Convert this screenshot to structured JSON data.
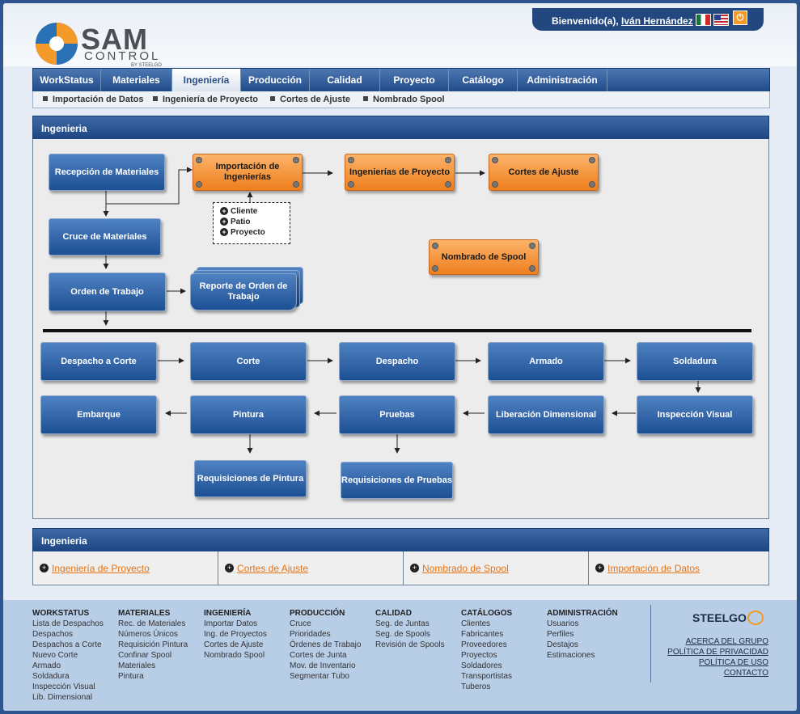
{
  "header": {
    "welcome": "Bienvenido(a),",
    "user": "Iván Hernández",
    "logo_main": "SAM",
    "logo_sub": "CONTROL",
    "logo_by": "BY STEELGO"
  },
  "nav": {
    "tabs": [
      "WorkStatus",
      "Materiales",
      "Ingeniería",
      "Producción",
      "Calidad",
      "Proyecto",
      "Catálogo",
      "Administración"
    ],
    "active": "Ingeniería"
  },
  "subnav": [
    "Importación de Datos",
    "Ingeniería de Proyecto",
    "Cortes de Ajuste",
    "Nombrado Spool"
  ],
  "panel1": {
    "title": "Ingenieria"
  },
  "diagram": {
    "recepcion": "Recepción de Materiales",
    "importacion": "Importación de Ingenierías",
    "ingenierias": "Ingenierías de Proyecto",
    "cortes_ajuste": "Cortes de Ajuste",
    "legend": [
      "Cliente",
      "Patio",
      "Proyecto"
    ],
    "cruce": "Cruce de Materiales",
    "nombrado": "Nombrado de Spool",
    "orden": "Orden de Trabajo",
    "reporte": "Reporte de Orden de Trabajo",
    "despacho_corte": "Despacho a Corte",
    "corte": "Corte",
    "despacho": "Despacho",
    "armado": "Armado",
    "soldadura": "Soldadura",
    "embarque": "Embarque",
    "pintura": "Pintura",
    "pruebas": "Pruebas",
    "liberacion": "Liberación Dimensional",
    "inspeccion": "Inspección Visual",
    "req_pintura": "Requisiciones de Pintura",
    "req_pruebas": "Requisiciones de Pruebas"
  },
  "panel2": {
    "title": "Ingenieria",
    "links": [
      "Ingeniería de Proyecto",
      "Cortes de Ajuste",
      "Nombrado de Spool",
      "Importación de Datos"
    ]
  },
  "footer": {
    "columns": [
      {
        "title": "WORKSTATUS",
        "items": [
          "Lista de Despachos",
          "Despachos",
          "Despachos a Corte",
          "Nuevo Corte",
          "Armado",
          "Soldadura",
          "Inspección Visual",
          "Lib. Dimensional"
        ]
      },
      {
        "title": "MATERIALES",
        "items": [
          "Rec. de Materiales",
          "Números Únicos",
          "Requisición Pintura",
          "Confinar Spool",
          "Materiales",
          "Pintura"
        ]
      },
      {
        "title": "INGENIERÍA",
        "items": [
          "Importar Datos",
          "Ing. de Proyectos",
          "Cortes de Ajuste",
          "Nombrado Spool"
        ]
      },
      {
        "title": "PRODUCCIÓN",
        "items": [
          "Cruce",
          "Prioridades",
          "Órdenes de Trabajo",
          "Cortes de Junta",
          "Mov. de Inventario",
          "Segmentar Tubo"
        ]
      },
      {
        "title": "CALIDAD",
        "items": [
          "Seg. de Juntas",
          "Seg. de Spools",
          "Revisión de Spools"
        ]
      },
      {
        "title": "CATÁLOGOS",
        "items": [
          "Clientes",
          "Fabricantes",
          "Proveedores",
          "Proyectos",
          "Soldadores",
          "Transportistas",
          "Tuberos"
        ]
      },
      {
        "title": "ADMINISTRACIÓN",
        "items": [
          "Usuarios",
          "Perfiles",
          "Destajos",
          "Estimaciones"
        ]
      }
    ],
    "brand": "STEELGO",
    "links": [
      "ACERCA DEL GRUPO",
      "POLÍTICA DE PRIVACIDAD",
      "POLÍTICA DE USO",
      "CONTACTO"
    ]
  },
  "colors": {
    "nav": "#1f4b89",
    "box_blue": "#1d4f94",
    "box_orange": "#ef7e1e",
    "link": "#e67313",
    "footer": "#b8cde6"
  }
}
